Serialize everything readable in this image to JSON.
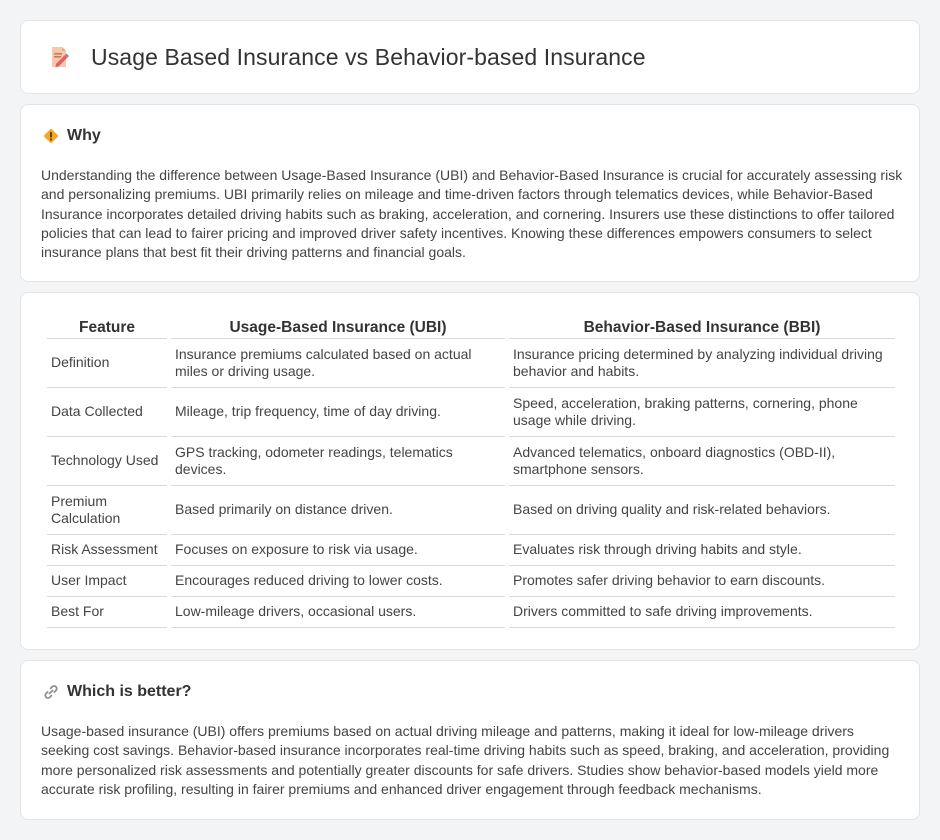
{
  "page": {
    "title": "Usage Based Insurance vs Behavior-based Insurance"
  },
  "why": {
    "heading": "Why",
    "icon": "warning-diamond-icon",
    "text": "Understanding the difference between Usage-Based Insurance (UBI) and Behavior-Based Insurance is crucial for accurately assessing risk and personalizing premiums. UBI primarily relies on mileage and time-driven factors through telematics devices, while Behavior-Based Insurance incorporates detailed driving habits such as braking, acceleration, and cornering. Insurers use these distinctions to offer tailored policies that can lead to fairer pricing and improved driver safety incentives. Knowing these differences empowers consumers to select insurance plans that best fit their driving patterns and financial goals."
  },
  "comparison": {
    "headers": [
      "Feature",
      "Usage-Based Insurance (UBI)",
      "Behavior-Based Insurance (BBI)"
    ],
    "rows": [
      [
        "Definition",
        "Insurance premiums calculated based on actual miles or driving usage.",
        "Insurance pricing determined by analyzing individual driving behavior and habits."
      ],
      [
        "Data Collected",
        "Mileage, trip frequency, time of day driving.",
        "Speed, acceleration, braking patterns, cornering, phone usage while driving."
      ],
      [
        "Technology Used",
        "GPS tracking, odometer readings, telematics devices.",
        "Advanced telematics, onboard diagnostics (OBD-II), smartphone sensors."
      ],
      [
        "Premium Calculation",
        "Based primarily on distance driven.",
        "Based on driving quality and risk-related behaviors."
      ],
      [
        "Risk Assessment",
        "Focuses on exposure to risk via usage.",
        "Evaluates risk through driving habits and style."
      ],
      [
        "User Impact",
        "Encourages reduced driving to lower costs.",
        "Promotes safer driving behavior to earn discounts."
      ],
      [
        "Best For",
        "Low-mileage drivers, occasional users.",
        "Drivers committed to safe driving improvements."
      ]
    ]
  },
  "better": {
    "heading": "Which is better?",
    "icon": "link-icon",
    "text": "Usage-based insurance (UBI) offers premiums based on actual driving mileage and patterns, making it ideal for low-mileage drivers seeking cost savings. Behavior-based insurance incorporates real-time driving habits such as speed, braking, and acceleration, providing more personalized risk assessments and potentially greater discounts for safe drivers. Studies show behavior-based models yield more accurate risk profiling, resulting in fairer premiums and enhanced driver engagement through feedback mechanisms."
  },
  "colors": {
    "background": "#f3f4f6",
    "card": "#ffffff",
    "icon_accent": "#f08a4b",
    "why_icon": "#f5a623"
  }
}
